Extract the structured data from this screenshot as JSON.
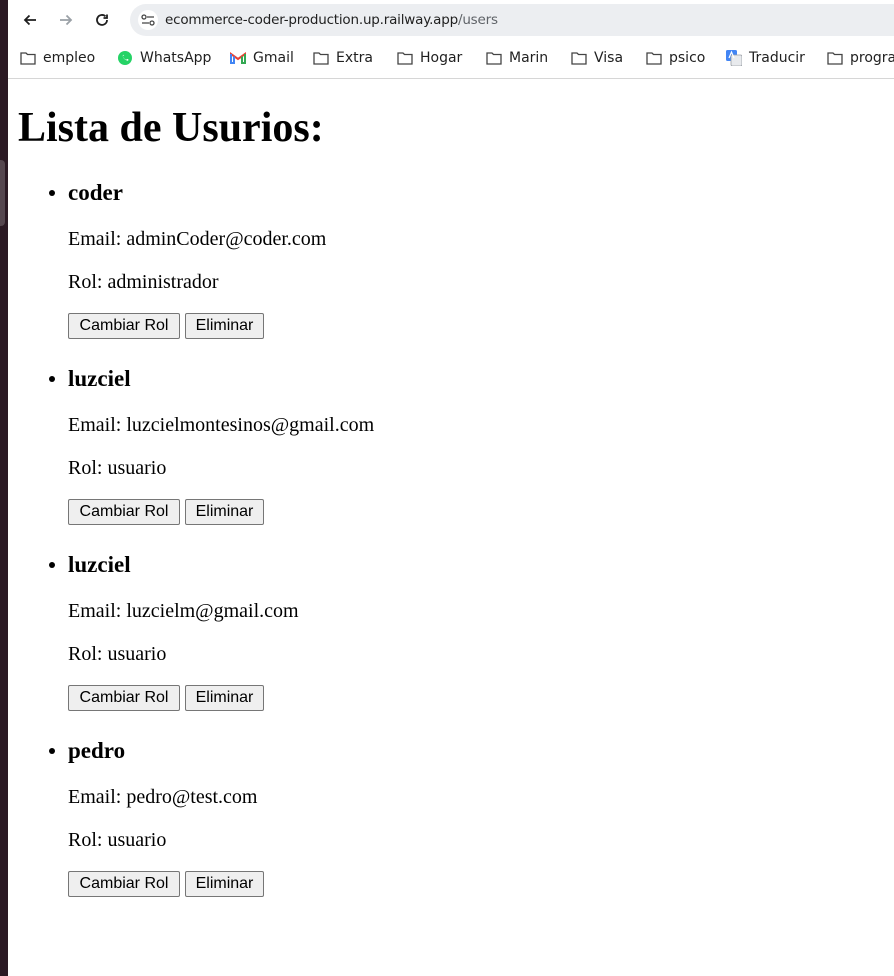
{
  "browser": {
    "url_domain": "ecommerce-coder-production.up.railway.app",
    "url_path": "/users",
    "bookmarks": [
      {
        "label": "empleo",
        "icon": "folder-icon"
      },
      {
        "label": "WhatsApp",
        "icon": "whatsapp-icon"
      },
      {
        "label": "Gmail",
        "icon": "gmail-icon"
      },
      {
        "label": "Extra",
        "icon": "folder-icon"
      },
      {
        "label": "Hogar",
        "icon": "folder-icon"
      },
      {
        "label": "Marin",
        "icon": "folder-icon"
      },
      {
        "label": "Visa",
        "icon": "folder-icon"
      },
      {
        "label": "psico",
        "icon": "folder-icon"
      },
      {
        "label": "Traducir",
        "icon": "translate-icon"
      },
      {
        "label": "progra",
        "icon": "folder-icon"
      }
    ]
  },
  "page": {
    "title": "Lista de Usurios:",
    "users": [
      {
        "name": "coder",
        "email": "Email: adminCoder@coder.com",
        "role": "Rol: administrador"
      },
      {
        "name": "luzciel",
        "email": "Email: luzcielmontesinos@gmail.com",
        "role": "Rol: usuario"
      },
      {
        "name": "luzciel",
        "email": "Email: luzcielm@gmail.com",
        "role": "Rol: usuario"
      },
      {
        "name": "pedro",
        "email": "Email: pedro@test.com",
        "role": "Rol: usuario"
      }
    ],
    "change_role_label": "Cambiar Rol",
    "delete_label": "Eliminar"
  },
  "colors": {
    "omnibox_bg": "#eceef1",
    "button_bg": "#efefef",
    "button_border": "#767676",
    "whatsapp_green": "#25d366",
    "translate_blue": "#4285f4"
  }
}
